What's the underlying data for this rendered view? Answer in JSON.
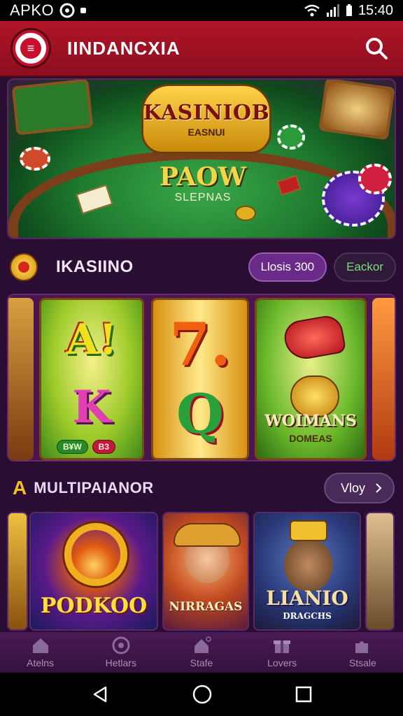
{
  "status_bar": {
    "carrier": "APKO",
    "time": "15:40"
  },
  "header": {
    "title": "IINDANCXIA"
  },
  "hero": {
    "badge_title": "KASINIOB",
    "badge_sub": "EASNUI",
    "main_text": "PAOW",
    "sub_text": "SLEPNAS"
  },
  "casino_section": {
    "title": "IKASIINO",
    "pill_primary": "Llosis 300",
    "pill_secondary": "Eackor"
  },
  "reels": {
    "r1_top": "A!",
    "r1_bottom": "K",
    "r1_pill_left": "B¥W",
    "r1_pill_right": "B3",
    "r2_top": "7.",
    "r2_bottom": "Q",
    "r3_title": "WOIMANS",
    "r3_sub": "DOMEAS"
  },
  "multi_section": {
    "icon": "A",
    "title": "MULTIPAIANOR",
    "view_label": "Vloy"
  },
  "tiles": [
    {
      "label": "PODKOO"
    },
    {
      "label": "NIRRAGAS"
    },
    {
      "label": "LIANIO",
      "sub": "DRAGCHS"
    }
  ],
  "bottom_nav": [
    {
      "label": "Atelns",
      "icon": "home-icon"
    },
    {
      "label": "Hetlars",
      "icon": "target-icon"
    },
    {
      "label": "Stafe",
      "icon": "house-icon"
    },
    {
      "label": "Lovers",
      "icon": "gift-icon"
    },
    {
      "label": "Stsale",
      "icon": "puzzle-icon"
    }
  ],
  "colors": {
    "header": "#b01628",
    "background": "#2a0d33",
    "accent_purple": "#6a2a88"
  }
}
